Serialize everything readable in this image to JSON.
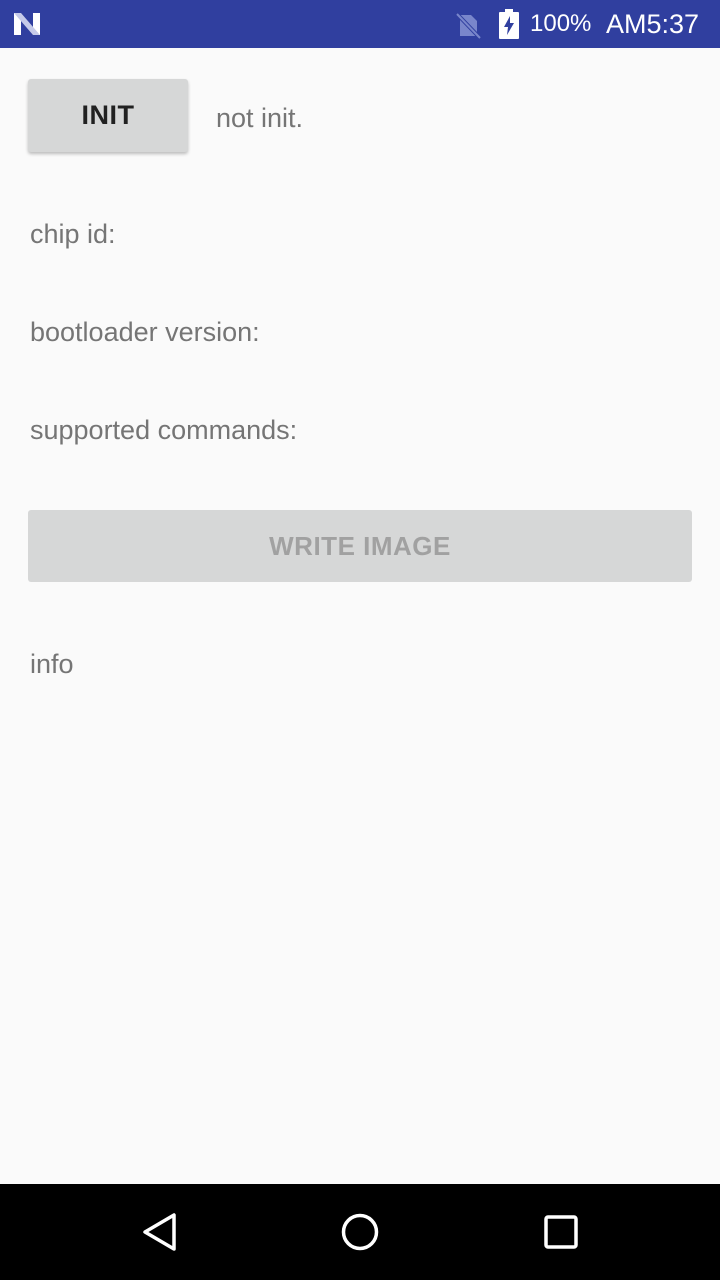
{
  "status_bar": {
    "battery_percent": "100%",
    "time": "AM5:37",
    "background_color": "#303f9f",
    "icons": [
      "android-n-icon",
      "no-sim-icon",
      "battery-charging-icon"
    ]
  },
  "main": {
    "init_button_label": "INIT",
    "init_status": "not init.",
    "chip_id_label": "chip id:",
    "bootloader_version_label": "bootloader version:",
    "supported_commands_label": "supported commands:",
    "write_image_button_label": "WRITE IMAGE",
    "write_image_enabled": false,
    "info_text": "info"
  },
  "nav_bar": {
    "icons": [
      "back-icon",
      "home-icon",
      "recents-icon"
    ]
  }
}
